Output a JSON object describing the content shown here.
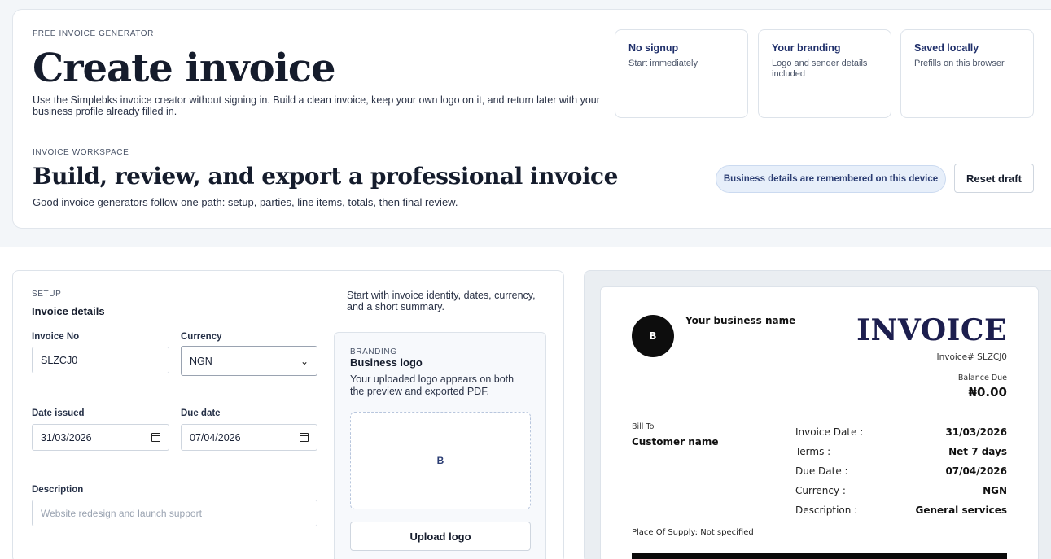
{
  "hero": {
    "eyebrow": "FREE INVOICE GENERATOR",
    "title": "Create invoice",
    "intro": "Use the Simplebks invoice creator without signing in. Build a clean invoice, keep your own logo on it, and return later with your business profile already filled in.",
    "features": [
      {
        "title": "No signup",
        "desc": "Start immediately"
      },
      {
        "title": "Your branding",
        "desc": "Logo and sender details included"
      },
      {
        "title": "Saved locally",
        "desc": "Prefills on this browser"
      }
    ]
  },
  "workspace": {
    "eyebrow": "INVOICE WORKSPACE",
    "title": "Build, review, and export a professional invoice",
    "subtitle": "Good invoice generators follow one path: setup, parties, line items, totals, then final review.",
    "pill": "Business details are remembered on this device",
    "reset_label": "Reset draft"
  },
  "setup": {
    "eyebrow": "SETUP",
    "title": "Invoice details",
    "help": "Start with invoice identity, dates, currency, and a short summary.",
    "invoice_no_label": "Invoice No",
    "invoice_no": "SLZCJ0",
    "currency_label": "Currency",
    "currency": "NGN",
    "date_issued_label": "Date issued",
    "date_issued": "31/03/2026",
    "due_date_label": "Due date",
    "due_date": "07/04/2026",
    "description_label": "Description",
    "description_placeholder": "Website redesign and launch support"
  },
  "branding": {
    "eyebrow": "BRANDING",
    "title": "Business logo",
    "desc": "Your uploaded logo appears on both the preview and exported PDF.",
    "logo_letter": "B",
    "upload_label": "Upload logo"
  },
  "preview": {
    "avatar_letter": "B",
    "business_name": "Your business name",
    "title": "INVOICE",
    "invoice_number": "Invoice# SLZCJ0",
    "balance_label": "Balance Due",
    "balance_value": "₦0.00",
    "bill_to_label": "Bill To",
    "customer_name": "Customer name",
    "meta": [
      {
        "label": "Invoice Date :",
        "value": "31/03/2026"
      },
      {
        "label": "Terms :",
        "value": "Net 7 days"
      },
      {
        "label": "Due Date :",
        "value": "07/04/2026"
      },
      {
        "label": "Currency :",
        "value": "NGN"
      },
      {
        "label": "Description :",
        "value": "General services"
      }
    ],
    "place_of_supply": "Place Of Supply: Not specified"
  }
}
